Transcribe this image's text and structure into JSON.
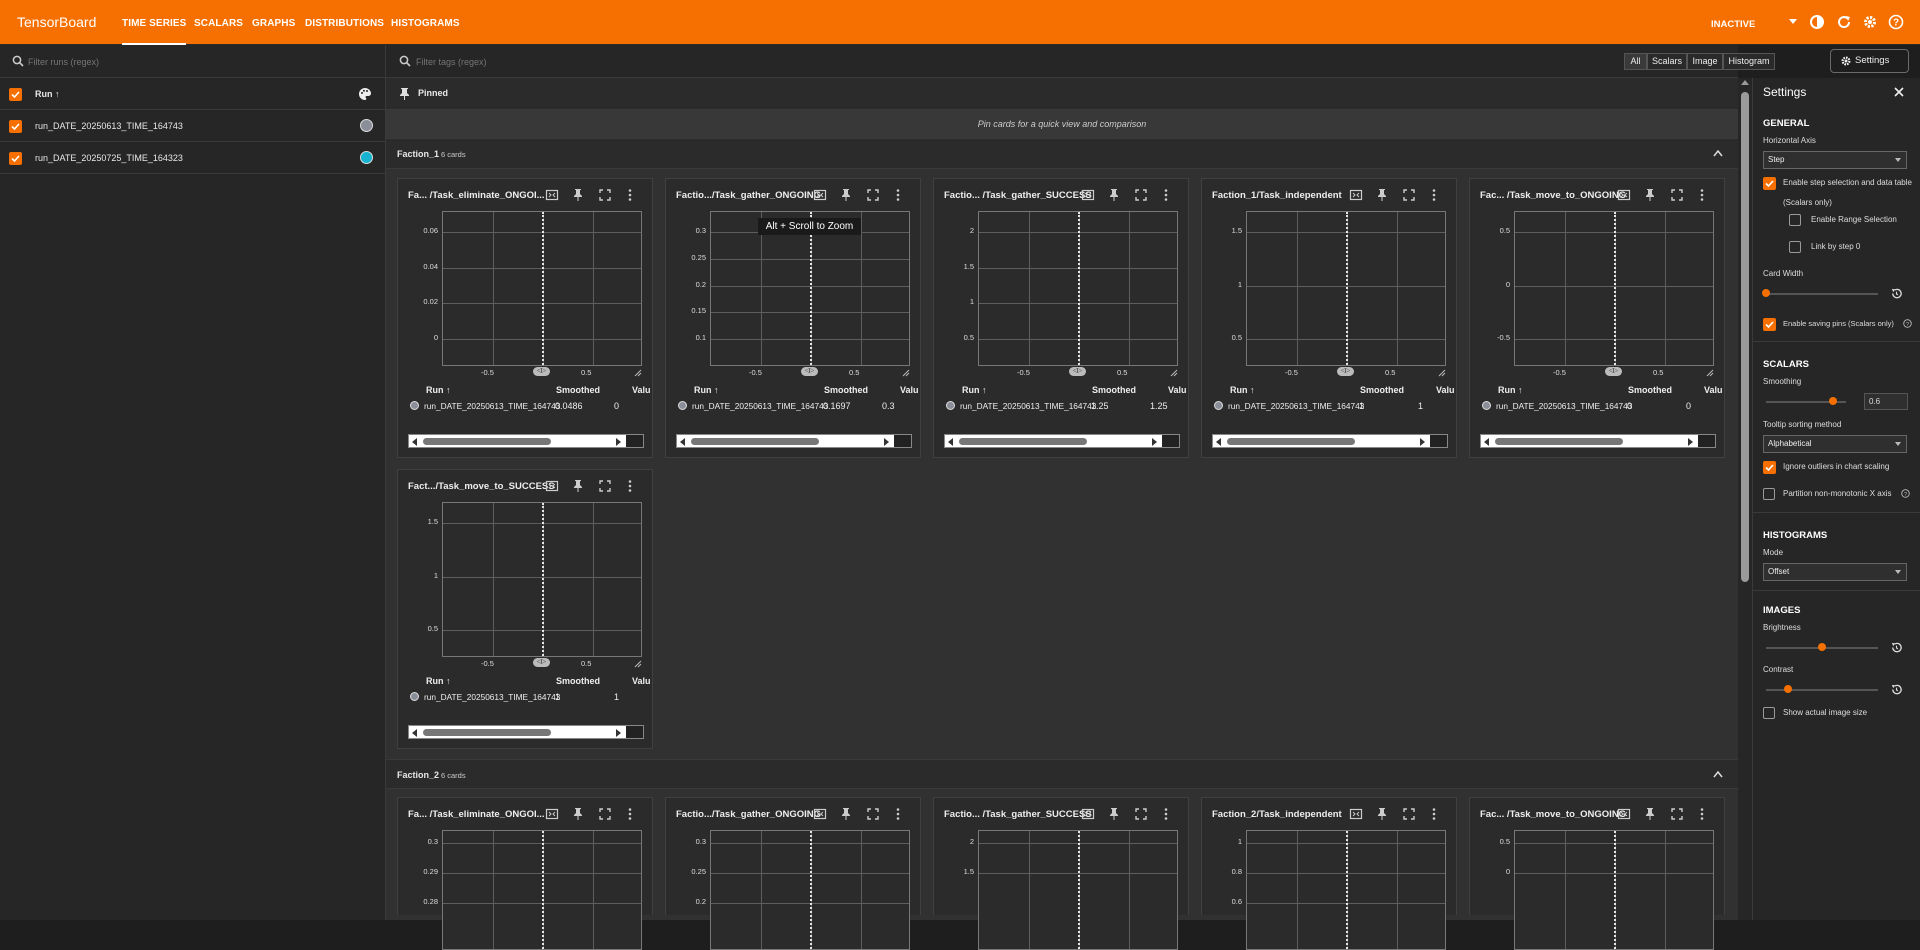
{
  "app": {
    "brand": "TensorBoard",
    "status": "INACTIVE"
  },
  "nav": {
    "tabs": [
      {
        "label": "TIME SERIES"
      },
      {
        "label": "SCALARS"
      },
      {
        "label": "GRAPHS"
      },
      {
        "label": "DISTRIBUTIONS"
      },
      {
        "label": "HISTOGRAMS"
      }
    ]
  },
  "sidebar": {
    "filter_placeholder": "Filter runs (regex)",
    "header": "Run ↑",
    "runs": [
      {
        "name": "run_DATE_20250613_TIME_164743",
        "color": "#8a8e99"
      },
      {
        "name": "run_DATE_20250725_TIME_164323",
        "color": "#17b3d1"
      }
    ]
  },
  "toolbar": {
    "filter_placeholder": "Filter tags (regex)",
    "types": [
      "All",
      "Scalars",
      "Image",
      "Histogram"
    ],
    "settings_label": "Settings"
  },
  "pinned": {
    "title": "Pinned",
    "hint": "Pin cards for a quick view and comparison"
  },
  "groups": [
    {
      "name": "Faction_1",
      "count": "6 cards"
    },
    {
      "name": "Faction_2",
      "count": "6 cards"
    }
  ],
  "table_headers": {
    "run": "Run ↑",
    "smoothed": "Smoothed",
    "value": "Valu"
  },
  "zoom_tooltip": "Alt + Scroll to Zoom",
  "cards": [
    {
      "title": "Fa... /Task_eliminate_ONGOI...",
      "yticks": [
        "0.06",
        "0.04",
        "0.02",
        "0"
      ],
      "xticks": [
        "-0.5",
        "0.5"
      ],
      "run": "run_DATE_20250613_TIME_164743",
      "smoothed": "0.0486",
      "value": "0"
    },
    {
      "title": "Factio.../Task_gather_ONGOING",
      "yticks": [
        "0.3",
        "0.25",
        "0.2",
        "0.15",
        "0.1"
      ],
      "xticks": [
        "-0.5",
        "0.5"
      ],
      "run": "run_DATE_20250613_TIME_164743",
      "smoothed": "0.1697",
      "value": "0.3"
    },
    {
      "title": "Factio... /Task_gather_SUCCESS",
      "yticks": [
        "2",
        "1.5",
        "1",
        "0.5"
      ],
      "xticks": [
        "-0.5",
        "0.5"
      ],
      "run": "run_DATE_20250613_TIME_164743",
      "smoothed": "1.25",
      "value": "1.25"
    },
    {
      "title": "Faction_1/Task_independent",
      "yticks": [
        "1.5",
        "1",
        "0.5"
      ],
      "xticks": [
        "-0.5",
        "0.5"
      ],
      "run": "run_DATE_20250613_TIME_164743",
      "smoothed": "1",
      "value": "1"
    },
    {
      "title": "Fac... /Task_move_to_ONGOING",
      "yticks": [
        "0.5",
        "0",
        "-0.5"
      ],
      "xticks": [
        "-0.5",
        "0.5"
      ],
      "run": "run_DATE_20250613_TIME_164743",
      "smoothed": "0",
      "value": "0"
    },
    {
      "title": "Fact.../Task_move_to_SUCCESS",
      "yticks": [
        "1.5",
        "1",
        "0.5"
      ],
      "xticks": [
        "-0.5",
        "0.5"
      ],
      "run": "run_DATE_20250613_TIME_164743",
      "smoothed": "1",
      "value": "1"
    }
  ],
  "cards2": [
    {
      "title": "Fa... /Task_eliminate_ONGOI...",
      "yticks": [
        "0.3",
        "0.29",
        "0.28"
      ]
    },
    {
      "title": "Factio.../Task_gather_ONGOING",
      "yticks": [
        "0.3",
        "0.25",
        "0.2"
      ]
    },
    {
      "title": "Factio... /Task_gather_SUCCESS",
      "yticks": [
        "2",
        "1.5"
      ]
    },
    {
      "title": "Faction_2/Task_independent",
      "yticks": [
        "1",
        "0.8",
        "0.6"
      ]
    },
    {
      "title": "Fac... /Task_move_to_ONGOING",
      "yticks": [
        "0.5",
        "0"
      ]
    }
  ],
  "settings": {
    "title": "Settings",
    "general": {
      "heading": "GENERAL",
      "horizontal_axis_label": "Horizontal Axis",
      "horizontal_axis_value": "Step",
      "enable_step_selection": "Enable step selection and data table",
      "scalars_only": "(Scalars only)",
      "enable_range": "Enable Range Selection",
      "link_step0": "Link by step 0",
      "card_width": "Card Width",
      "card_width_level": 0.0,
      "enable_pins": "Enable saving pins (Scalars only)"
    },
    "scalars": {
      "heading": "SCALARS",
      "smoothing_label": "Smoothing",
      "smoothing_value": "0.6",
      "smoothing_level": 0.6,
      "tooltip_label": "Tooltip sorting method",
      "tooltip_value": "Alphabetical",
      "ignore_outliers": "Ignore outliers in chart scaling",
      "partition": "Partition non-monotonic X axis"
    },
    "histograms": {
      "heading": "HISTOGRAMS",
      "mode_label": "Mode",
      "mode_value": "Offset"
    },
    "images": {
      "heading": "IMAGES",
      "brightness_label": "Brightness",
      "brightness_level": 0.5,
      "contrast_label": "Contrast",
      "contrast_level": 0.2,
      "actual_size": "Show actual image size"
    }
  },
  "colors": {
    "accent": "#f57000",
    "run1": "#8a8e99",
    "run2": "#17b3d1"
  }
}
